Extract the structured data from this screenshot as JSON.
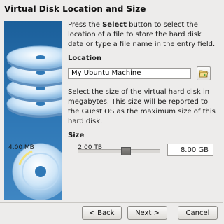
{
  "header": {
    "title": "Virtual Disk Location and Size"
  },
  "instructions": {
    "pre": "Press the ",
    "select_word": "Select",
    "post": " button to select the location of a file to store the hard disk data or type a file name in the entry field."
  },
  "location": {
    "label": "Location",
    "value": "My Ubuntu Machine"
  },
  "size_description": "Select the size of the virtual hard disk in megabytes. This size will be reported to the Guest OS as the maximum size of this hard disk.",
  "size": {
    "label": "Size",
    "value": "8.00 GB",
    "min_label": "4.00 MB",
    "max_label": "2.00 TB",
    "slider_fraction": 0.64
  },
  "buttons": {
    "back": "< Back",
    "next": "Next >",
    "cancel": "Cancel"
  },
  "icons": {
    "folder": "folder-open-icon",
    "side": "disk-stack-image"
  },
  "colors": {
    "side_panel": "#2f78b6",
    "disk": "#cfe6f8"
  }
}
